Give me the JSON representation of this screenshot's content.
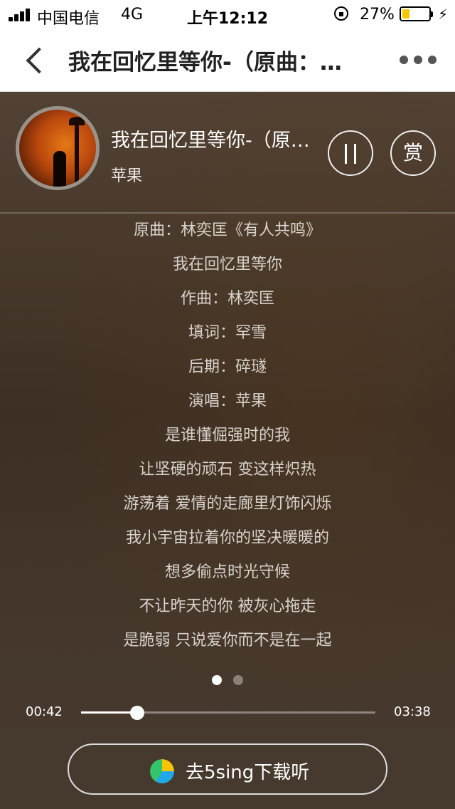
{
  "status_bar": {
    "carrier": "中国电信",
    "network": "4G",
    "time": "上午12:12",
    "battery_percent": "27%",
    "battery_level": 0.27,
    "icons": [
      "signal-bars-icon",
      "orientation-lock-icon",
      "battery-icon",
      "charging-bolt-icon"
    ]
  },
  "nav": {
    "title": "我在回忆里等你-（原曲：…",
    "icons": [
      "back-chevron-icon",
      "more-dots-icon"
    ]
  },
  "player": {
    "song_title": "我在回忆里等你-（原…",
    "artist": "苹果",
    "reward_label": "赏",
    "icons": [
      "pause-icon"
    ]
  },
  "lyrics": [
    "原曲：林奕匡《有人共鸣》",
    "我在回忆里等你",
    "作曲：林奕匡",
    "填词：罕雪",
    "后期：碎璲",
    "演唱：苹果",
    "是谁懂倔强时的我",
    "让坚硬的顽石 变这样炽热",
    "游荡着 爱情的走廊里灯饰闪烁",
    "我小宇宙拉着你的坚决暖暖的",
    "想多偷点时光守候",
    "不让昨天的你 被灰心拖走",
    "是脆弱 只说爱你而不是在一起"
  ],
  "pager": {
    "pages": 2,
    "active_index": 0
  },
  "progress": {
    "current": "00:42",
    "total": "03:38",
    "fraction": 0.19
  },
  "download": {
    "label": "去5sing下载听",
    "icon": "5sing-logo-icon"
  },
  "colors": {
    "accent_white": "#ffffff",
    "battery_fill": "#f3c800",
    "player_bg": "#3d2f24",
    "logo_green": "#34c46a",
    "logo_yellow": "#f7c400",
    "logo_blue": "#20a8e8"
  }
}
